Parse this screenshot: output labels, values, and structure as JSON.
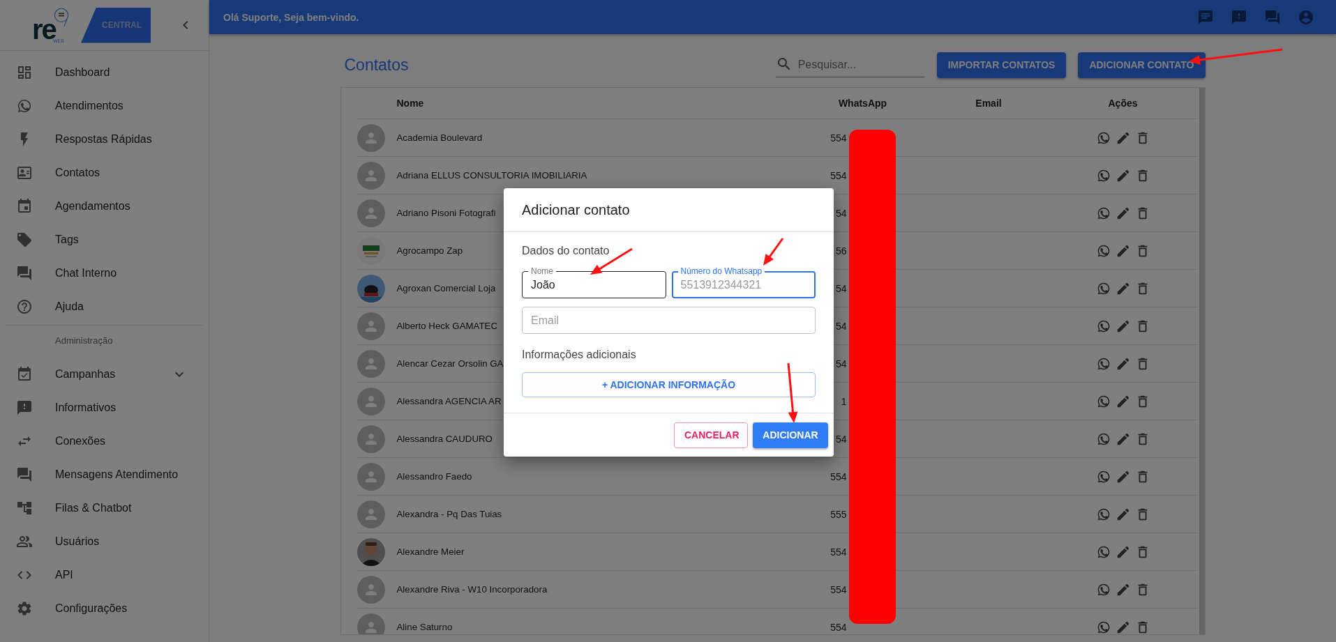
{
  "sidebar": {
    "logo": {
      "wordmark": "re",
      "subtitle": "WEB",
      "badge": "CENTRAL"
    },
    "items": [
      {
        "label": "Dashboard",
        "kind": "link"
      },
      {
        "label": "Atendimentos",
        "kind": "link"
      },
      {
        "label": "Respostas Rápidas",
        "kind": "link"
      },
      {
        "label": "Contatos",
        "kind": "link"
      },
      {
        "label": "Agendamentos",
        "kind": "link"
      },
      {
        "label": "Tags",
        "kind": "link"
      },
      {
        "label": "Chat Interno",
        "kind": "link"
      },
      {
        "label": "Ajuda",
        "kind": "link"
      }
    ],
    "section": "Administração",
    "admin_items": [
      {
        "label": "Campanhas",
        "kind": "group",
        "expanded": false
      },
      {
        "label": "Informativos",
        "kind": "link"
      },
      {
        "label": "Conexões",
        "kind": "link"
      },
      {
        "label": "Mensagens Atendimento",
        "kind": "link"
      },
      {
        "label": "Filas & Chatbot",
        "kind": "link"
      },
      {
        "label": "Usuários",
        "kind": "link"
      },
      {
        "label": "API",
        "kind": "link"
      },
      {
        "label": "Configurações",
        "kind": "link"
      }
    ]
  },
  "header": {
    "greeting": "Olá Suporte, Seja bem-vindo."
  },
  "page": {
    "title": "Contatos",
    "search": {
      "placeholder": "Pesquisar..."
    },
    "buttons": [
      "IMPORTAR CONTATOS",
      "ADICIONAR CONTATO"
    ]
  },
  "table": {
    "columns": [
      "Nome",
      "WhatsApp",
      "Email",
      "Ações"
    ],
    "rows": [
      {
        "name": "Academia Boulevard",
        "whatsapp": "554",
        "kind": "avatar"
      },
      {
        "name": "Adriana ELLUS CONSULTORIA IMOBILIARIA",
        "whatsapp": "554",
        "kind": "avatar"
      },
      {
        "name": "Adriano Pisoni Fotografi",
        "whatsapp": "54",
        "kind": "avatar"
      },
      {
        "name": "Agrocampo Zap",
        "whatsapp": "56",
        "kind": "picture"
      },
      {
        "name": "Agroxan Comercial Loja",
        "whatsapp": "54",
        "kind": "picture"
      },
      {
        "name": "Alberto Heck GAMATEC",
        "whatsapp": "54",
        "kind": "avatar"
      },
      {
        "name": "Alencar Cezar Orsolin GA",
        "whatsapp": "54",
        "kind": "avatar"
      },
      {
        "name": "Alessandra AGENCIA AR",
        "whatsapp": "1",
        "kind": "avatar"
      },
      {
        "name": "Alessandra CAUDURO",
        "whatsapp": "54",
        "kind": "avatar"
      },
      {
        "name": "Alessandro Faedo",
        "whatsapp": "554",
        "kind": "avatar"
      },
      {
        "name": "Alexandra - Pq Das Tuias",
        "whatsapp": "555",
        "kind": "avatar"
      },
      {
        "name": "Alexandre Meier",
        "whatsapp": "554",
        "kind": "picture"
      },
      {
        "name": "Alexandre Riva - W10 Incorporadora",
        "whatsapp": "554",
        "kind": "avatar"
      },
      {
        "name": "Aline Saturno",
        "whatsapp": "554",
        "kind": "avatar"
      }
    ]
  },
  "dialog": {
    "title": "Adicionar contato",
    "section": "Dados do contato",
    "fields": [
      {
        "label": "Nome",
        "value": "João",
        "focused": false,
        "hovered": true
      },
      {
        "label": "Número do Whatsapp",
        "placeholder": "5513912344321",
        "focused": true,
        "hovered": false
      },
      {
        "placeholder": "Email",
        "focused": false,
        "hovered": false
      }
    ],
    "extra_section": "Informações adicionais",
    "add_button": "+ ADICIONAR INFORMAÇÃO",
    "buttons": [
      {
        "label": "CANCELAR",
        "kind": "secondary"
      },
      {
        "label": "ADICIONAR",
        "kind": "primary"
      }
    ]
  }
}
